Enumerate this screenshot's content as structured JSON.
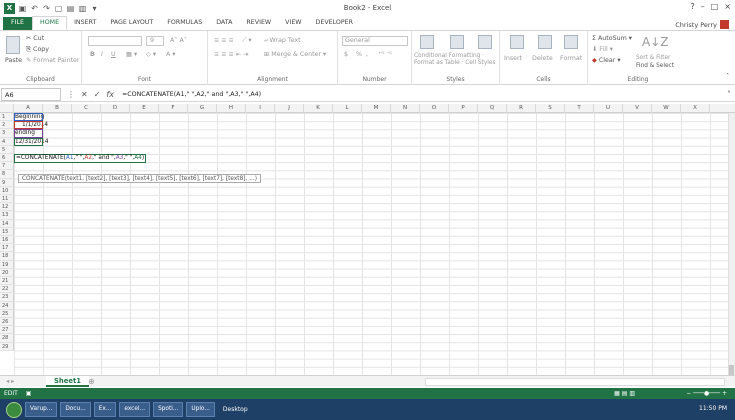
{
  "title": "Book2 - Excel",
  "user": "Christy Perry",
  "window_controls": {
    "help": "?",
    "minimize": "–",
    "maximize": "□",
    "close": "×"
  },
  "ribbon_tabs": [
    "FILE",
    "HOME",
    "INSERT",
    "PAGE LAYOUT",
    "FORMULAS",
    "DATA",
    "REVIEW",
    "VIEW",
    "DEVELOPER"
  ],
  "active_tab": "HOME",
  "clipboard": {
    "paste": "Paste",
    "cut": "Cut",
    "copy": "Copy",
    "format_painter": "Format Painter",
    "label": "Clipboard"
  },
  "font": {
    "size": "9",
    "bold": "B",
    "italic": "I",
    "underline": "U",
    "label": "Font"
  },
  "alignment": {
    "wrap_text": "Wrap Text",
    "merge_center": "Merge & Center",
    "label": "Alignment"
  },
  "number": {
    "format": "General",
    "currency": "$",
    "percent": "%",
    "comma": ",",
    "label": "Number"
  },
  "styles": {
    "conditional": "Conditional Formatting",
    "format_table": "Format as Table",
    "cell_styles": "Cell Styles",
    "label": "Styles"
  },
  "cells": {
    "insert": "Insert",
    "delete": "Delete",
    "format": "Format",
    "label": "Cells"
  },
  "editing": {
    "autosum": "AutoSum",
    "fill": "Fill",
    "clear": "Clear",
    "sort_filter": "Sort & Filter",
    "find_select": "Find & Select",
    "label": "Editing"
  },
  "name_box": "A6",
  "formula": "=CONCATENATE(A1,\" \",A2,\" and \",A3,\" \",A4)",
  "columns": [
    "A",
    "B",
    "C",
    "D",
    "E",
    "F",
    "G",
    "H",
    "I",
    "J",
    "K",
    "L",
    "M",
    "N",
    "O",
    "P",
    "Q",
    "R",
    "S",
    "T",
    "U",
    "V",
    "W",
    "X"
  ],
  "rows": [
    "1",
    "2",
    "3",
    "4",
    "5",
    "6",
    "7",
    "8",
    "9",
    "10",
    "11",
    "12",
    "13",
    "14",
    "15",
    "16",
    "17",
    "18",
    "19",
    "20",
    "21",
    "22",
    "23",
    "24",
    "25",
    "26",
    "27",
    "28",
    "29"
  ],
  "cell_values": {
    "A1": "Beginning",
    "A2": "1/1/2014",
    "A3": "ending",
    "A4": "12/31/2014"
  },
  "editing_cell": {
    "prefix": "=CONCATENATE(",
    "r1": "A1",
    "sep1": ",\" \",",
    "r2": "A2",
    "sep2": ",\" and \",",
    "r3": "A3",
    "sep3": ",\" \",",
    "r4": "A4",
    "suffix": ")"
  },
  "tooltip": "CONCATENATE(text1, [text2], [text3], [text4], [text5], [text6], [text7], [text8], ...)",
  "sheet_tab": "Sheet1",
  "add_sheet": "⊕",
  "status_mode": "EDIT",
  "taskbar": {
    "items": [
      "Varup...",
      "Docu...",
      "Ex...",
      "excel...",
      "Spoti...",
      "Uplo..."
    ],
    "desktop": "Desktop",
    "time": "11:50 PM"
  },
  "colors": {
    "excel_green": "#217346",
    "ref_a1": "#2b63c7",
    "ref_a2": "#c0392b",
    "ref_a3": "#7b3fa0",
    "ref_a4": "#217346"
  }
}
